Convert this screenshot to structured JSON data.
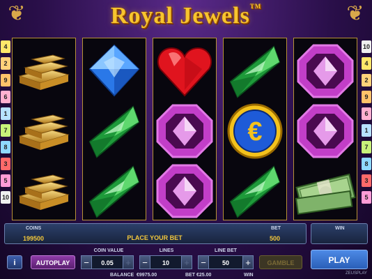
{
  "game": {
    "title": "Royal Jewels",
    "trademark": "TM"
  },
  "reels": [
    [
      "gold-bars",
      "gold-bars",
      "gold-bars"
    ],
    [
      "blue-diamond",
      "green-emerald",
      "green-emerald"
    ],
    [
      "red-heart",
      "purple-gem",
      "purple-gem"
    ],
    [
      "green-emerald",
      "euro-coin",
      "green-emerald"
    ],
    [
      "purple-gem",
      "purple-gem",
      "cash-stack"
    ]
  ],
  "paylines": {
    "left": [
      "4",
      "2",
      "9",
      "6",
      "1",
      "7",
      "8",
      "3",
      "5",
      "10"
    ],
    "right": [
      "10",
      "4",
      "2",
      "9",
      "6",
      "1",
      "7",
      "8",
      "3",
      "5"
    ],
    "colors": {
      "1": "#b7e2ff",
      "2": "#ffd27a",
      "3": "#ff6a6a",
      "4": "#ffe76a",
      "5": "#ff9cd6",
      "6": "#ffb0d0",
      "7": "#c8f27a",
      "8": "#8fd9ff",
      "9": "#ffc36a",
      "10": "#f0f0f0"
    }
  },
  "info_bar": {
    "coins_label": "COINS",
    "coins_value": "199500",
    "message": "PLACE YOUR BET",
    "bet_label": "BET",
    "bet_value": "500",
    "win_label": "WIN"
  },
  "controls": {
    "info_label": "i",
    "autoplay_label": "AUTOPLAY",
    "coin_value_label": "COIN VALUE",
    "coin_value": "0.05",
    "lines_label": "LINES",
    "lines": "10",
    "line_bet_label": "LINE BET",
    "line_bet": "50",
    "gamble_label": "GAMBLE",
    "play_label": "PLAY",
    "minus": "−",
    "plus": "+"
  },
  "status": {
    "balance_label": "BALANCE",
    "balance": "€9975.00",
    "bet_label": "BET",
    "bet": "€25.00",
    "win_label": "WIN"
  },
  "brand": "ZEUSPLAY",
  "accent": {
    "gold": "#f7c52e",
    "panel": "#18243e",
    "play": "#2a5fb8"
  }
}
